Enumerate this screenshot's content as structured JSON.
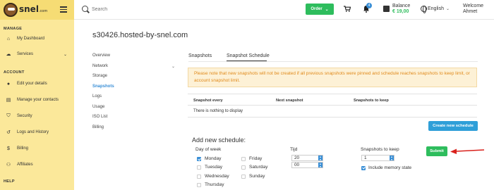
{
  "header": {
    "logo_text": "snel",
    "logo_suffix": ".com",
    "search_placeholder": "Search",
    "order_label": "Order",
    "notification_count": "4",
    "balance_label": "Balance",
    "balance_value": "€ 19,00",
    "language": "English",
    "welcome_line1": "Welcome",
    "welcome_line2": "Ahmet"
  },
  "sidebar": {
    "sections": [
      "MANAGE",
      "ACCOUNT",
      "HELP"
    ],
    "manage_items": [
      {
        "label": "My Dashboard",
        "icon": "home-icon"
      },
      {
        "label": "Services",
        "icon": "cloud-icon"
      }
    ],
    "account_items": [
      {
        "label": "Edit your details",
        "icon": "user-icon"
      },
      {
        "label": "Manage your contacts",
        "icon": "contacts-icon"
      },
      {
        "label": "Security",
        "icon": "shield-icon"
      },
      {
        "label": "Logs and History",
        "icon": "history-icon"
      },
      {
        "label": "Billing",
        "icon": "dollar-icon"
      },
      {
        "label": "Affiliates",
        "icon": "affiliates-icon"
      }
    ]
  },
  "main": {
    "title": "s30426.hosted-by-snel.com",
    "subnav": [
      "Overview",
      "Network",
      "Storage",
      "Snapshots",
      "Logs",
      "Usage",
      "ISO List",
      "Billing"
    ],
    "tabs": [
      "Snapshots",
      "Snapshot Schedule"
    ],
    "notice": "Please note that new snapshots will not be created if all previous snapshots were pinned and schedule reaches snapshots to keep limit, or account snapshot limit.",
    "table": {
      "columns": [
        "Snapshot every",
        "Next snapshot",
        "Snapshots to keep"
      ],
      "empty_text": "There is nothing to display"
    },
    "create_button": "Create new schedule",
    "form": {
      "heading": "Add new schedule:",
      "day_label": "Day of week",
      "days": [
        {
          "label": "Monday",
          "checked": true
        },
        {
          "label": "Tuesday",
          "checked": false
        },
        {
          "label": "Wednesday",
          "checked": false
        },
        {
          "label": "Thursday",
          "checked": false
        },
        {
          "label": "Friday",
          "checked": false
        },
        {
          "label": "Saturday",
          "checked": false
        },
        {
          "label": "Sunday",
          "checked": false
        }
      ],
      "time_label": "Tijd",
      "hour": "20",
      "minute": "00",
      "keep_label": "Snapshots to keep",
      "keep_value": "1",
      "include_memory": "Include memory state",
      "submit": "Submit"
    }
  },
  "colors": {
    "sidebar_bg": "#fbe89a",
    "accent_green": "#2ebd5d",
    "accent_blue": "#2f9fd8",
    "notice_text": "#e08a1c",
    "annotation_arrow": "#d9211c"
  }
}
